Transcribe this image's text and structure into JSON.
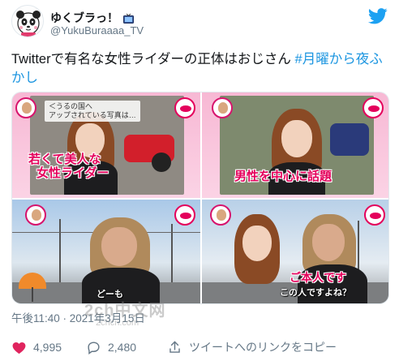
{
  "user": {
    "display_name": "ゆくブラっ！",
    "handle": "@YukuBuraaaa_TV"
  },
  "tweet": {
    "text": "Twitterで有名な女性ライダーの正体はおじさん ",
    "hashtag": "#月曜から夜ふかし"
  },
  "media": {
    "panel1": {
      "caption_box": "＜うるの国へ\nアップされている写真は…",
      "caption_line1": "若くて美人な",
      "caption_line2": "女性ライダー"
    },
    "panel2": {
      "caption": "男性を中心に話題"
    },
    "panel3": {
      "caption": "どーも"
    },
    "panel4": {
      "caption_main": "ご本人です",
      "caption_sub": "この人ですよね？"
    }
  },
  "timestamp": "午後11:40 · 2021年3月15日",
  "watermark": "2ch中文网",
  "watermark_sub": "2chcn.com",
  "actions": {
    "likes": "4,995",
    "replies": "2,480",
    "copy_link": "ツイートへのリンクをコピー"
  },
  "colors": {
    "hashtag": "#1b95e0",
    "twitter_blue": "#1da1f2",
    "like_red": "#e0245e",
    "meta_gray": "#657786"
  },
  "icons": [
    "twitter-bird-icon",
    "tv-icon",
    "heart-icon",
    "reply-bubble-icon",
    "share-link-icon"
  ]
}
